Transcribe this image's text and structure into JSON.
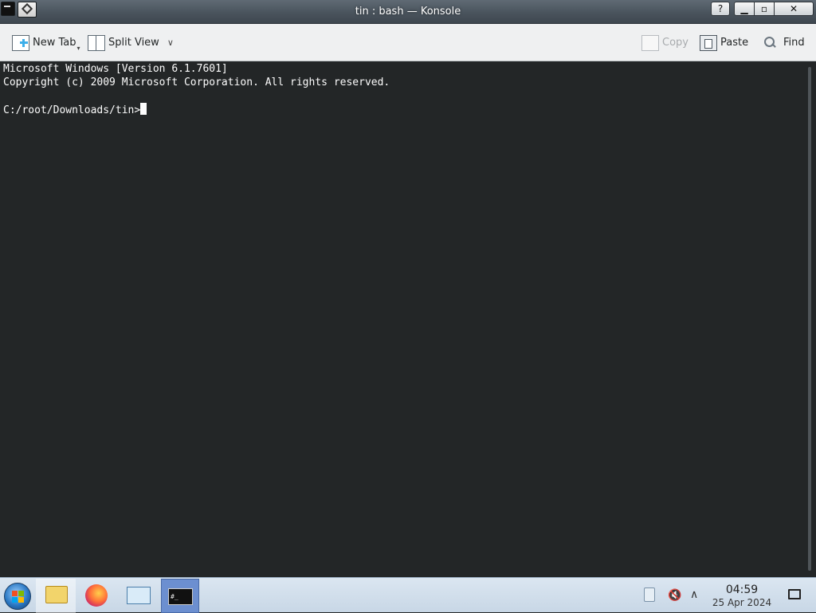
{
  "window": {
    "title": "tin : bash — Konsole",
    "buttons": {
      "help": "?",
      "minimize": "▁",
      "maximize": "▫",
      "close": "✕"
    }
  },
  "toolbar": {
    "new_tab": "New Tab",
    "split_view": "Split View",
    "copy": "Copy",
    "paste": "Paste",
    "find": "Find"
  },
  "terminal": {
    "lines": [
      "Microsoft Windows [Version 6.1.7601]",
      "Copyright (c) 2009 Microsoft Corporation. All rights reserved.",
      "",
      "C:/root/Downloads/tin>"
    ]
  },
  "taskbar": {
    "konsole_icon_text": "#_",
    "clock": {
      "time": "04:59",
      "date": "25 Apr 2024"
    }
  },
  "colors": {
    "terminal_bg": "#232627",
    "terminal_fg": "#fcfcfc",
    "toolbar_bg": "#eff0f1",
    "active_task": "#6c8fd0"
  }
}
